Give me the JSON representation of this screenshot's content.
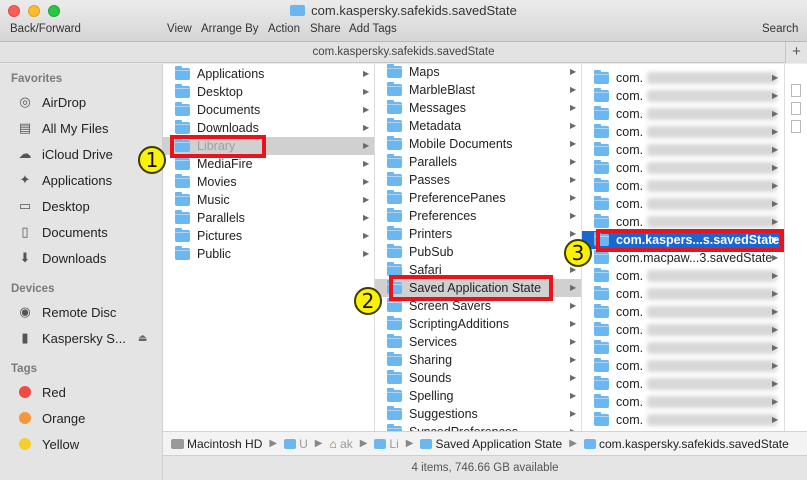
{
  "window": {
    "title": "com.kaspersky.safekids.savedState",
    "path_title": "com.kaspersky.safekids.savedState"
  },
  "toolbar": {
    "back_forward": "Back/Forward",
    "view": "View",
    "arrange_by": "Arrange By",
    "action": "Action",
    "share": "Share",
    "add_tags": "Add Tags",
    "search": "Search",
    "plus": "+"
  },
  "sidebar": {
    "favorites_header": "Favorites",
    "favorites": [
      {
        "label": "AirDrop",
        "icon": "airdrop-icon"
      },
      {
        "label": "All My Files",
        "icon": "files-icon"
      },
      {
        "label": "iCloud Drive",
        "icon": "cloud-icon"
      },
      {
        "label": "Applications",
        "icon": "applications-icon"
      },
      {
        "label": "Desktop",
        "icon": "desktop-icon"
      },
      {
        "label": "Documents",
        "icon": "documents-icon"
      },
      {
        "label": "Downloads",
        "icon": "downloads-icon"
      }
    ],
    "devices_header": "Devices",
    "devices": [
      {
        "label": "Remote Disc",
        "icon": "disc-icon"
      },
      {
        "label": "Kaspersky S...",
        "icon": "drive-icon"
      }
    ],
    "tags_header": "Tags",
    "tags": [
      {
        "label": "Red",
        "color": "#f04a45"
      },
      {
        "label": "Orange",
        "color": "#f7963a"
      },
      {
        "label": "Yellow",
        "color": "#f5cf2f"
      }
    ]
  },
  "column1": {
    "items": [
      "Applications",
      "Desktop",
      "Documents",
      "Downloads",
      "Library",
      "MediaFire",
      "Movies",
      "Music",
      "Parallels",
      "Pictures",
      "Public"
    ],
    "selected": "Library"
  },
  "column2": {
    "items": [
      "Maps",
      "MarbleBlast",
      "Messages",
      "Metadata",
      "Mobile Documents",
      "Parallels",
      "Passes",
      "PreferencePanes",
      "Preferences",
      "Printers",
      "PubSub",
      "Safari",
      "Saved Application State",
      "Screen Savers",
      "ScriptingAdditions",
      "Services",
      "Sharing",
      "Sounds",
      "Spelling",
      "Suggestions",
      "SyncedPreferences"
    ],
    "selected": "Saved Application State"
  },
  "column3": {
    "items": [
      "com.",
      "com.",
      "com.",
      "com.",
      "com.",
      "com.",
      "com.",
      "com.",
      "com.",
      "com.kaspers...s.savedState",
      "com.macpaw...3.savedState",
      "com.",
      "com.",
      "com.",
      "com.",
      "com.",
      "com.",
      "com.",
      "com.",
      "com."
    ],
    "selected": "com.kaspers...s.savedState"
  },
  "annotations": {
    "badge1": "1",
    "badge2": "2",
    "badge3": "3"
  },
  "pathbar": {
    "segments": [
      "Macintosh HD",
      "U",
      "ak",
      "Li",
      "Saved Application State",
      "com.kaspersky.safekids.savedState"
    ]
  },
  "status": {
    "text": "4 items, 746.66 GB available"
  }
}
